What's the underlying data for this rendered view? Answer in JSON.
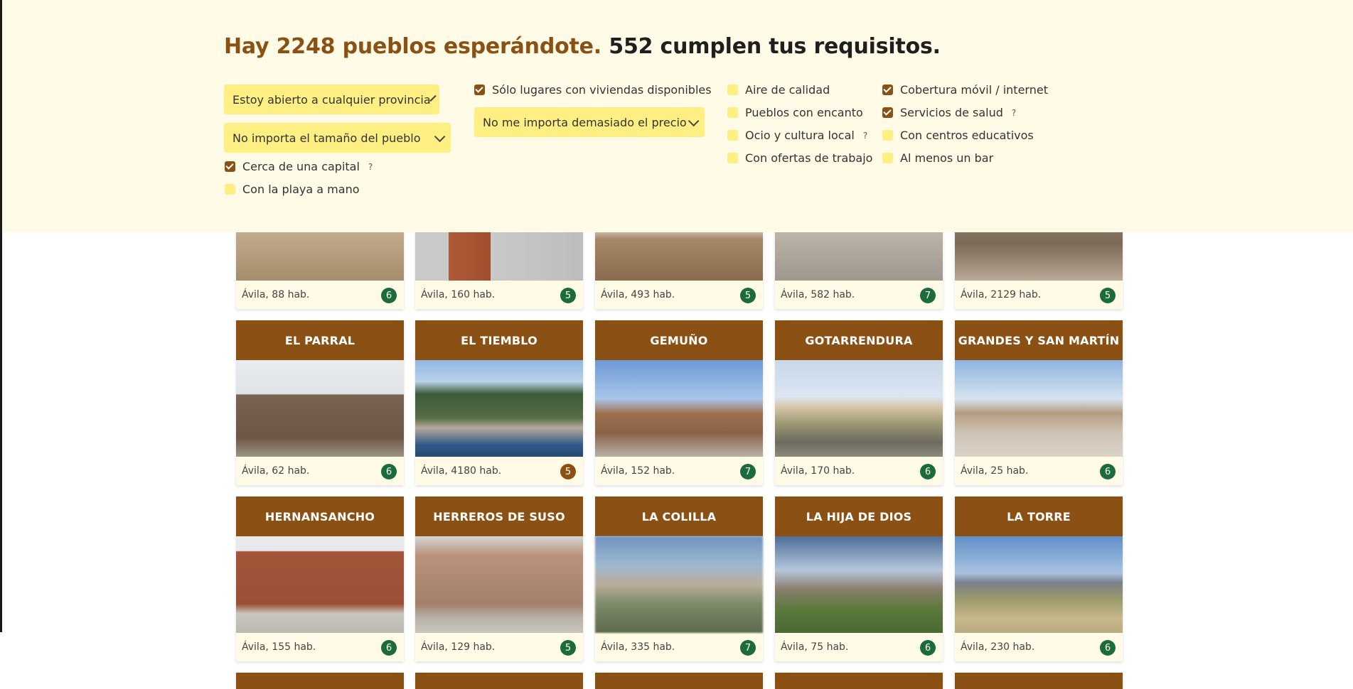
{
  "header": {
    "headline_part1": "Hay 2248 pueblos esperándote.",
    "headline_part2": "552 cumplen tus requisitos."
  },
  "filters": {
    "province_select": "Estoy abierto a cualquier provincia",
    "size_select": "No importa el tamaño del pueblo",
    "price_select": "No me importa demasiado el precio",
    "checkboxes": [
      {
        "label": "Cerca de una capital",
        "checked": true,
        "help": "?"
      },
      {
        "label": "Con la playa a mano",
        "checked": false
      },
      {
        "label": "Sólo lugares con viviendas disponibles",
        "checked": true
      },
      {
        "label": "Aire de calidad",
        "checked": false
      },
      {
        "label": "Pueblos con encanto",
        "checked": false
      },
      {
        "label": "Ocio y cultura local",
        "checked": false,
        "help": "?"
      },
      {
        "label": "Con ofertas de trabajo",
        "checked": false
      },
      {
        "label": "Cobertura móvil / internet",
        "checked": true
      },
      {
        "label": "Servicios de salud",
        "checked": true,
        "help": "?"
      },
      {
        "label": "Con centros educativos",
        "checked": false
      },
      {
        "label": "Al menos un bar",
        "checked": false
      }
    ]
  },
  "top_row": [
    {
      "info": "Ávila, 88 hab.",
      "score": "6"
    },
    {
      "info": "Ávila, 160 hab.",
      "score": "5"
    },
    {
      "info": "Ávila, 493 hab.",
      "score": "5"
    },
    {
      "info": "Ávila, 582 hab.",
      "score": "7"
    },
    {
      "info": "Ávila, 2129 hab.",
      "score": "5"
    }
  ],
  "row2": [
    {
      "name": "EL PARRAL",
      "info": "Ávila, 62 hab.",
      "score": "6"
    },
    {
      "name": "EL TIEMBLO",
      "info": "Ávila, 4180 hab.",
      "score": "5"
    },
    {
      "name": "GEMUÑO",
      "info": "Ávila, 152 hab.",
      "score": "7"
    },
    {
      "name": "GOTARRENDURA",
      "info": "Ávila, 170 hab.",
      "score": "6"
    },
    {
      "name": "GRANDES Y SAN MARTÍN",
      "info": "Ávila, 25 hab.",
      "score": "6"
    }
  ],
  "row3": [
    {
      "name": "HERNANSANCHO",
      "info": "Ávila, 155 hab.",
      "score": "6"
    },
    {
      "name": "HERREROS DE SUSO",
      "info": "Ávila, 129 hab.",
      "score": "5"
    },
    {
      "name": "LA COLILLA",
      "info": "Ávila, 335 hab.",
      "score": "7"
    },
    {
      "name": "LA HIJA DE DIOS",
      "info": "Ávila, 75 hab.",
      "score": "6"
    },
    {
      "name": "LA TORRE",
      "info": "Ávila, 230 hab.",
      "score": "6"
    }
  ],
  "colors": {
    "brand": "#8b5014",
    "accent": "#fdef82",
    "badge_green": "#1c6b3a",
    "panel": "#fffbe6"
  }
}
